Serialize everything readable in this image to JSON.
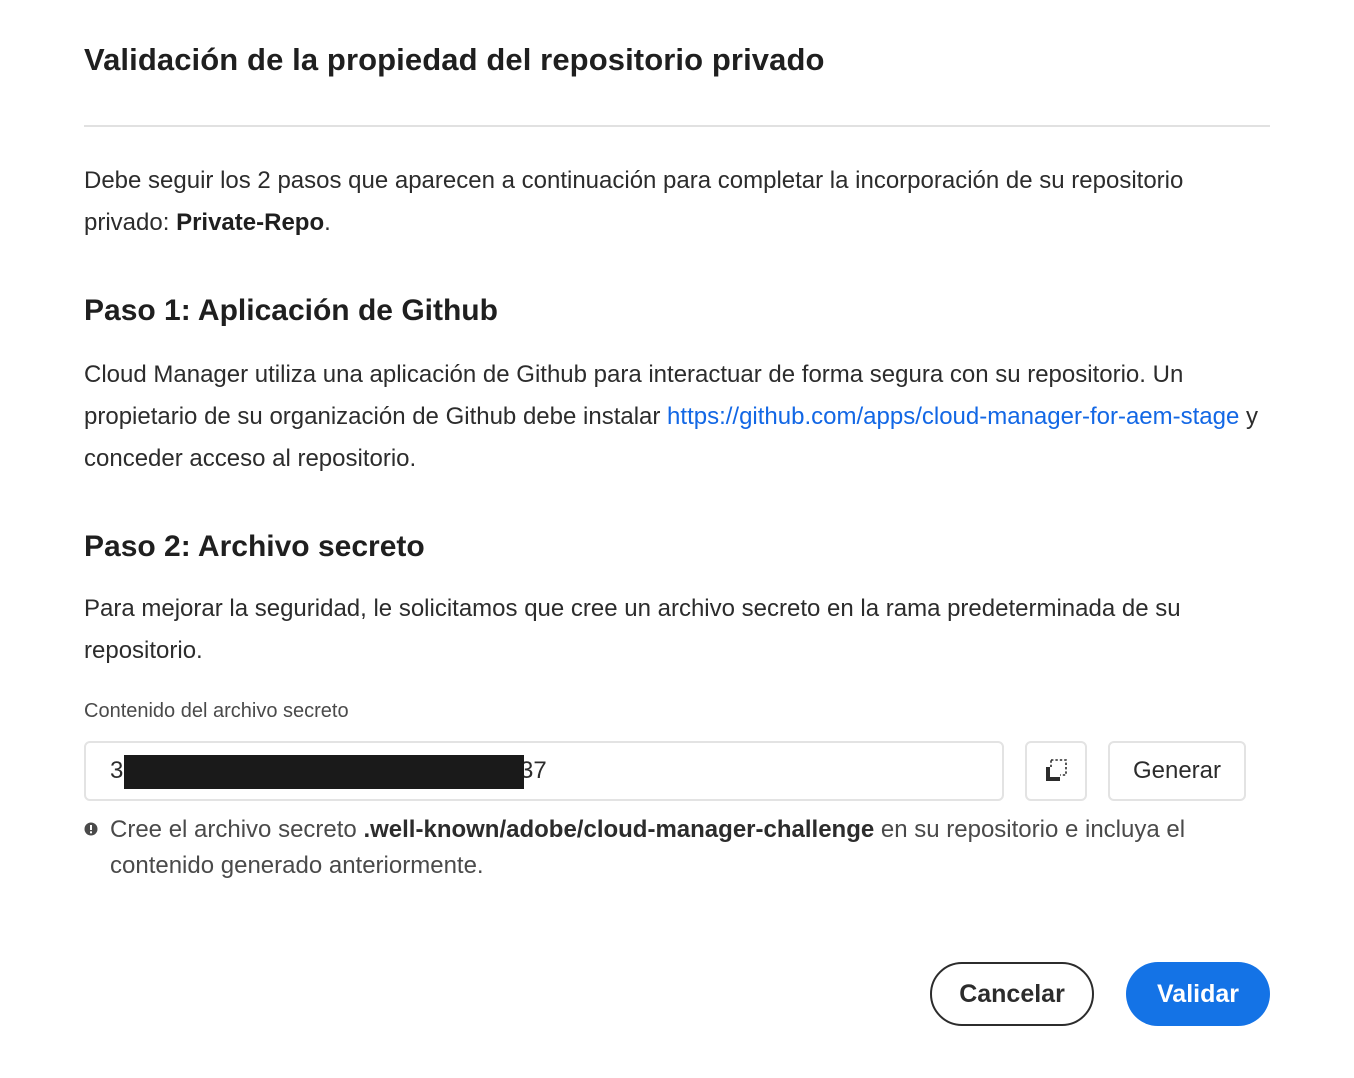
{
  "dialog": {
    "title": "Validación de la propiedad del repositorio privado",
    "intro": {
      "text": "Debe seguir los 2 pasos que aparecen a continuación para completar la incorporación de su repositorio privado: ",
      "repo_name": "Private-Repo",
      "suffix": "."
    },
    "step1": {
      "heading": "Paso 1: Aplicación de Github",
      "text_before": "Cloud Manager utiliza una aplicación de Github para interactuar de forma segura con su repositorio. Un propietario de su organización de Github debe instalar ",
      "link": "https://github.com/apps/cloud-manager-for-aem-stage",
      "text_after": " y conceder acceso al repositorio."
    },
    "step2": {
      "heading": "Paso 2: Archivo secreto",
      "text": "Para mejorar la seguridad, le solicitamos que cree un archivo secreto en la rama predeterminada de su repositorio.",
      "field_label": "Contenido del archivo secreto",
      "field_value_start": "3",
      "field_value_end": "37",
      "copy_icon": "copy-icon",
      "generate_label": "Generar",
      "help": {
        "icon": "info-icon",
        "text_before": "Cree el archivo secreto ",
        "path": ".well-known/adobe/cloud-manager-challenge",
        "text_after": " en su repositorio e incluya el contenido generado anteriormente."
      }
    },
    "actions": {
      "cancel_label": "Cancelar",
      "validate_label": "Validar"
    }
  },
  "colors": {
    "accent": "#1473e6",
    "link": "#1267e5",
    "text": "#2c2c2c",
    "redaction": "#1a1a1a"
  }
}
